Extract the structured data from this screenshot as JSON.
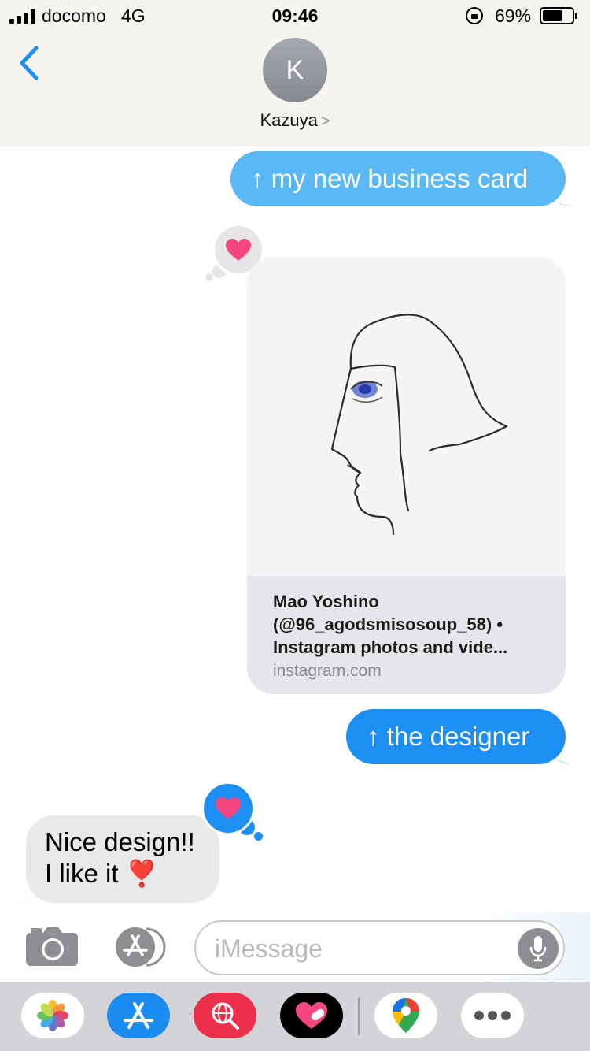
{
  "status_bar": {
    "carrier": "docomo",
    "network": "4G",
    "time": "09:46",
    "battery_percent": "69%",
    "battery_level": 0.69
  },
  "nav": {
    "avatar_initial": "K",
    "contact_name": "Kazuya",
    "contact_chevron": ">"
  },
  "messages": {
    "msg1": "↑ my new business card",
    "link_card": {
      "title_lines": [
        "Mao Yoshino",
        "(@96_agodsmisosoup_58) •",
        "Instagram photos and vide..."
      ],
      "domain": "instagram.com"
    },
    "msg3": "↑ the designer",
    "msg4_lines": [
      "Nice design!!",
      "I like it ❣️"
    ]
  },
  "input": {
    "placeholder": "iMessage"
  },
  "icons": {
    "back": "chevron-left-icon",
    "camera": "camera-icon",
    "apps": "app-store-icon",
    "mic": "microphone-icon",
    "tapback": "heart-icon"
  },
  "colors": {
    "imessage_blue": "#1d8ef2",
    "imessage_light_blue": "#5ab8f4",
    "received_gray": "#e9e9eb",
    "heart_pink": "#f5467f"
  }
}
